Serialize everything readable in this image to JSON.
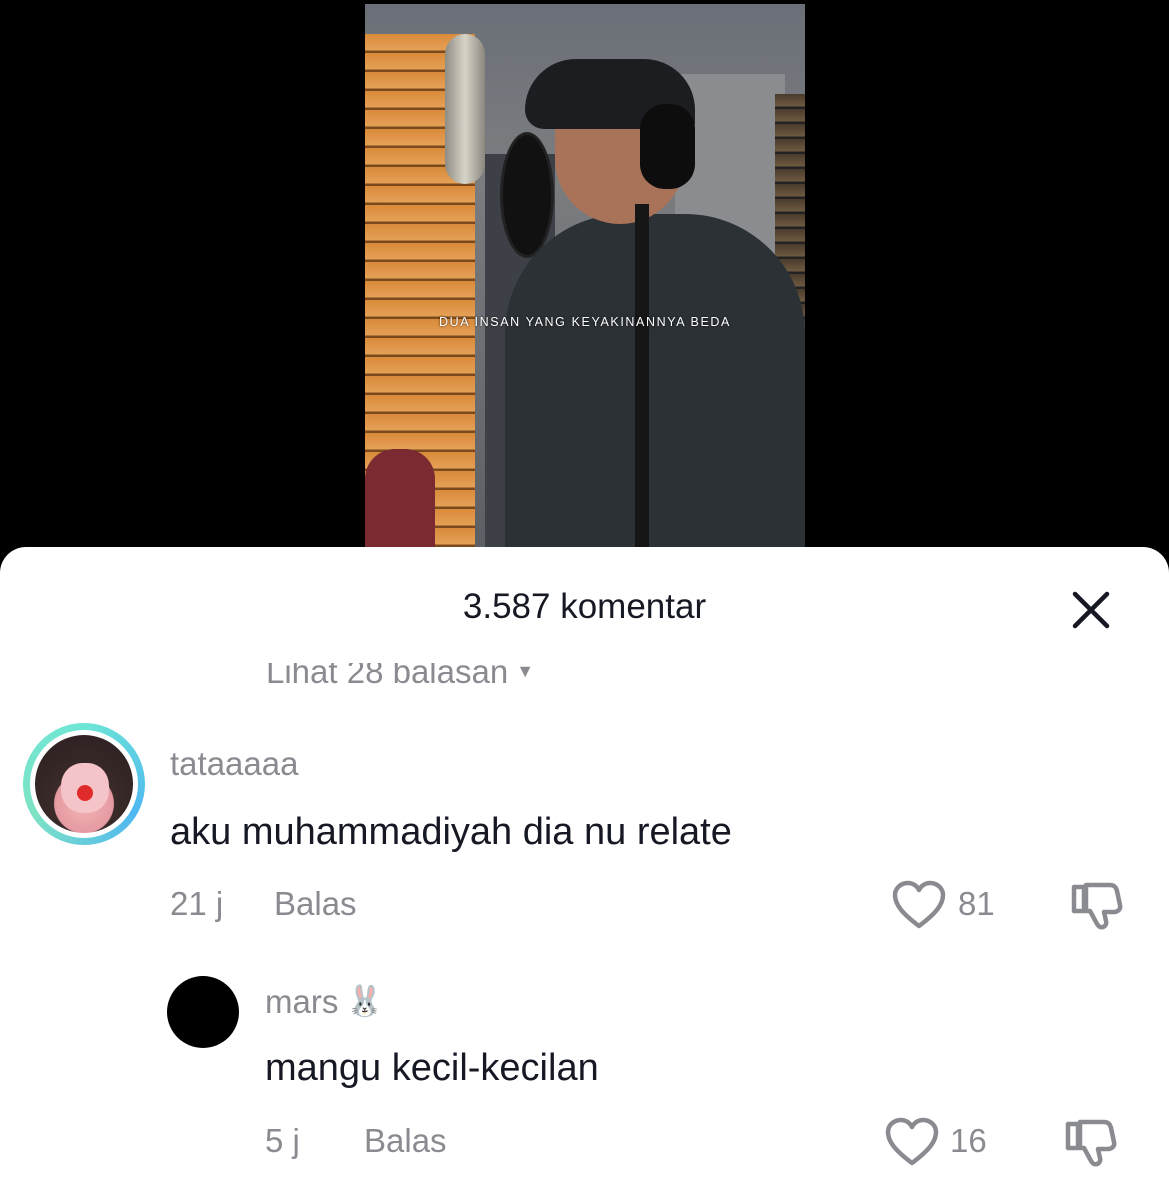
{
  "video": {
    "caption": "DUA INSAN YANG KEYAKINANNYA BEDA"
  },
  "sheet": {
    "title": "3.587 komentar",
    "view_replies": "Lihat 28 balasan"
  },
  "comments": [
    {
      "username": "tataaaaa",
      "text": "aku muhammadiyah dia nu relate",
      "time": "21 j",
      "reply_label": "Balas",
      "likes": "81"
    },
    {
      "username": "mars",
      "username_emoji": "🐰",
      "text": "mangu kecil-kecilan",
      "time": "5 j",
      "reply_label": "Balas",
      "likes": "16"
    }
  ],
  "colors": {
    "primary_text": "#161823",
    "secondary_text": "#8a8b91",
    "avatar_ring": "#4fb7f1"
  },
  "icons": {
    "close": "close-icon",
    "like": "heart-outline-icon",
    "dislike": "thumbs-down-icon",
    "chevron": "chevron-down-icon"
  }
}
